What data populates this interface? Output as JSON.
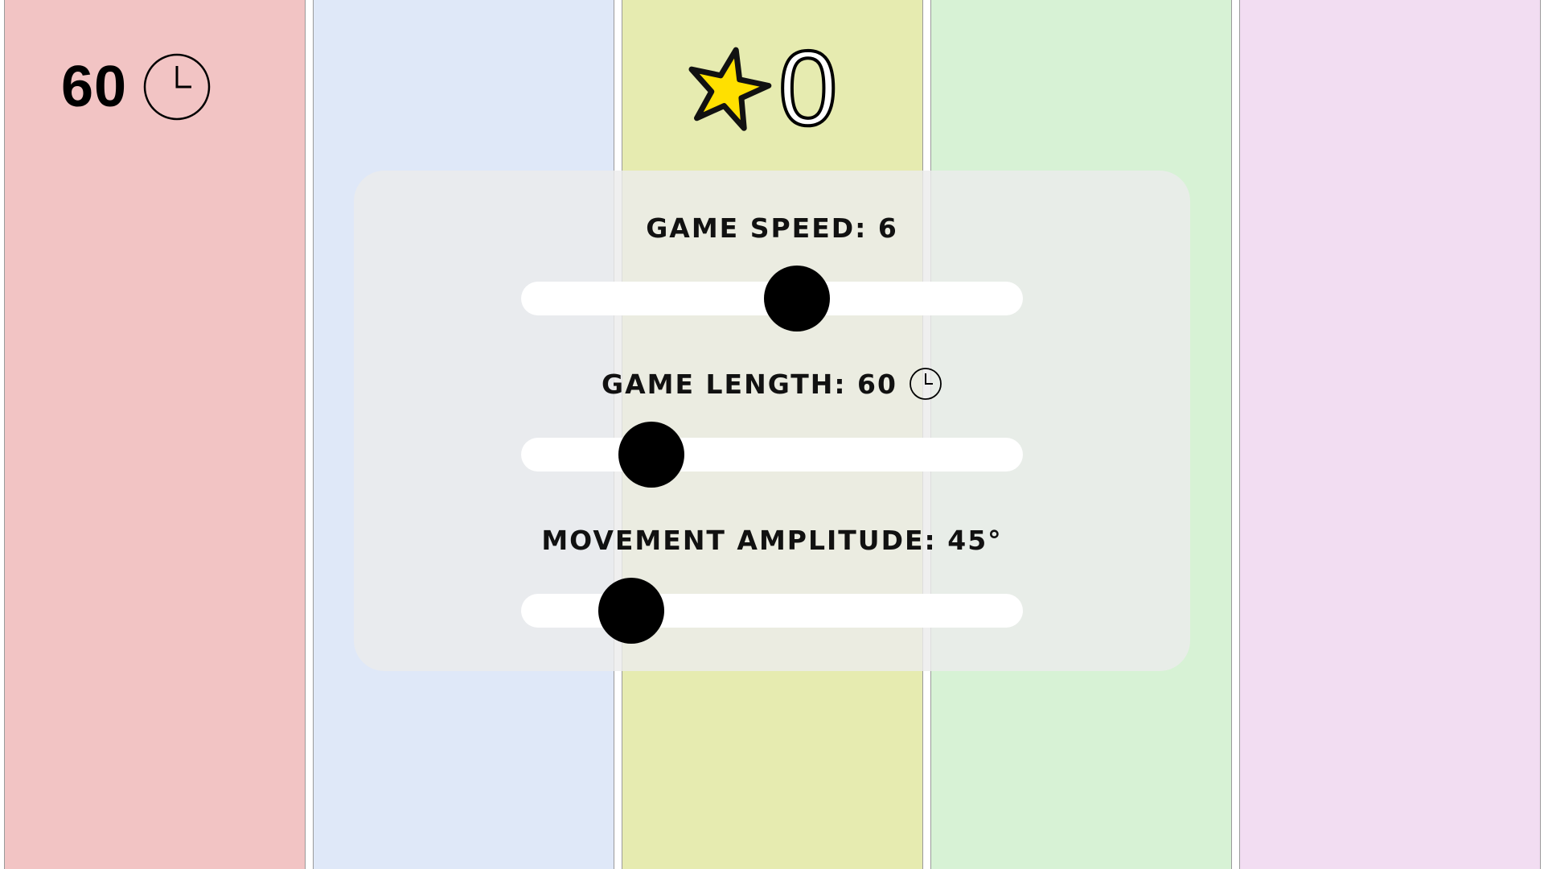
{
  "lanes": [
    {
      "color": "#f2c4c4"
    },
    {
      "color": "#dfe8f8"
    },
    {
      "color": "#e6ebb0"
    },
    {
      "color": "#d7f2d5"
    },
    {
      "color": "#f2ddf2"
    }
  ],
  "hud": {
    "timer_value": "60",
    "timer_icon": "clock-icon",
    "score_icon": "star-icon",
    "score_value": "0",
    "star_color": "#ffe000"
  },
  "settings": {
    "speed": {
      "label": "GAME SPEED: 6",
      "value": 6,
      "fraction": 0.55
    },
    "length": {
      "label": "GAME LENGTH: 60",
      "icon": "clock-icon",
      "value": 60,
      "fraction": 0.26
    },
    "amplitude": {
      "label": "MOVEMENT AMPLITUDE: 45°",
      "value": 45,
      "fraction": 0.22
    }
  }
}
